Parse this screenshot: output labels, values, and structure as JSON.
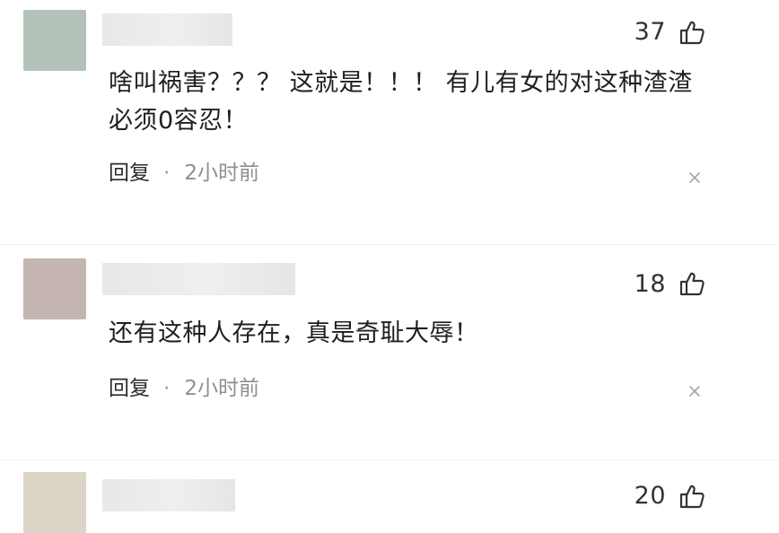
{
  "comments": [
    {
      "avatar_color": "#b3c2b8",
      "likes": "37",
      "text_lines": [
        "啥叫祸害？？？ 这就是！！！ 有儿有女的对这种渣渣",
        "必须0容忍！"
      ],
      "reply_label": "回复",
      "separator": "·",
      "time": "2小时前"
    },
    {
      "avatar_color": "#c4b5b3",
      "likes": "18",
      "text_lines": [
        "还有这种人存在，真是奇耻大辱！"
      ],
      "reply_label": "回复",
      "separator": "·",
      "time": "2小时前"
    },
    {
      "avatar_color": "#dcd4c6",
      "likes": "20",
      "text_lines": [],
      "reply_label": "",
      "separator": "",
      "time": ""
    }
  ],
  "icons": {
    "like": "thumbs-up-icon",
    "close": "close-icon"
  }
}
